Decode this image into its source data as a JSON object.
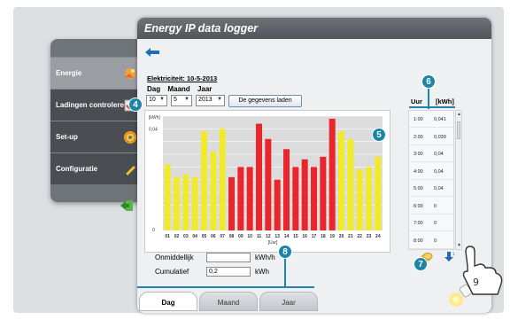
{
  "window": {
    "title": "Energy IP data logger"
  },
  "menu": {
    "items": [
      {
        "label": "Energie",
        "icon": "energy-hand-icon"
      },
      {
        "label": "Ladingen controleren",
        "icon": "loads-check-icon"
      },
      {
        "label": "Set-up",
        "icon": "gear-icon"
      },
      {
        "label": "Configuratie",
        "icon": "pencil-icon"
      }
    ]
  },
  "page": {
    "section_title": "Elektriciteit: 10-5-2013",
    "selectors": {
      "day_label": "Dag",
      "month_label": "Maand",
      "year_label": "Jaar",
      "day_value": "10",
      "month_value": "5",
      "year_value": "2013",
      "load_button": "De gegevens laden"
    }
  },
  "chart_data": {
    "type": "bar",
    "ylabel": "[kWh]",
    "xlabel": "[Uur]",
    "ylim": [
      0,
      0.045
    ],
    "yticks": [
      "0,04",
      "0"
    ],
    "categories": [
      "01",
      "02",
      "03",
      "04",
      "05",
      "06",
      "07",
      "08",
      "09",
      "10",
      "11",
      "12",
      "13",
      "14",
      "15",
      "16",
      "17",
      "18",
      "19",
      "20",
      "21",
      "22",
      "23",
      "24"
    ],
    "values": [
      0.026,
      0.021,
      0.022,
      0.021,
      0.039,
      0.031,
      0.04,
      0.021,
      0.025,
      0.025,
      0.042,
      0.036,
      0.02,
      0.032,
      0.025,
      0.028,
      0.025,
      0.029,
      0.044,
      0.039,
      0.036,
      0.024,
      0.025,
      0.029
    ],
    "colors": [
      "#f0ea2a",
      "#f0ea2a",
      "#f0ea2a",
      "#f0ea2a",
      "#f0ea2a",
      "#f0ea2a",
      "#f0ea2a",
      "#e8262b",
      "#e8262b",
      "#e8262b",
      "#e8262b",
      "#e8262b",
      "#e8262b",
      "#e8262b",
      "#e8262b",
      "#e8262b",
      "#e8262b",
      "#e8262b",
      "#e8262b",
      "#f0ea2a",
      "#f0ea2a",
      "#f0ea2a",
      "#f0ea2a",
      "#f0ea2a"
    ],
    "grid": true
  },
  "table": {
    "headers": [
      "Uur",
      "[kWh]"
    ],
    "rows": [
      [
        "1:00",
        "0,041"
      ],
      [
        "2:00",
        "0,039"
      ],
      [
        "3:00",
        "0,04"
      ],
      [
        "4:00",
        "0,04"
      ],
      [
        "5:00",
        "0,04"
      ],
      [
        "6:00",
        "0"
      ],
      [
        "7:00",
        "0"
      ],
      [
        "8:00",
        "0"
      ]
    ]
  },
  "fields": {
    "instant_label": "Onmiddellijk",
    "instant_value": "",
    "instant_unit": "kWh/h",
    "cumulative_label": "Cumulatief",
    "cumulative_value": "0,2",
    "cumulative_unit": "kWh"
  },
  "tabs": [
    "Dag",
    "Maand",
    "Jaar"
  ],
  "callouts": [
    "4",
    "5",
    "6",
    "7",
    "8",
    "9"
  ],
  "colors": {
    "accent": "#1b85a8",
    "header": "#5f6468",
    "bar_peak": "#e8262b",
    "bar_offpeak": "#f0ea2a"
  }
}
